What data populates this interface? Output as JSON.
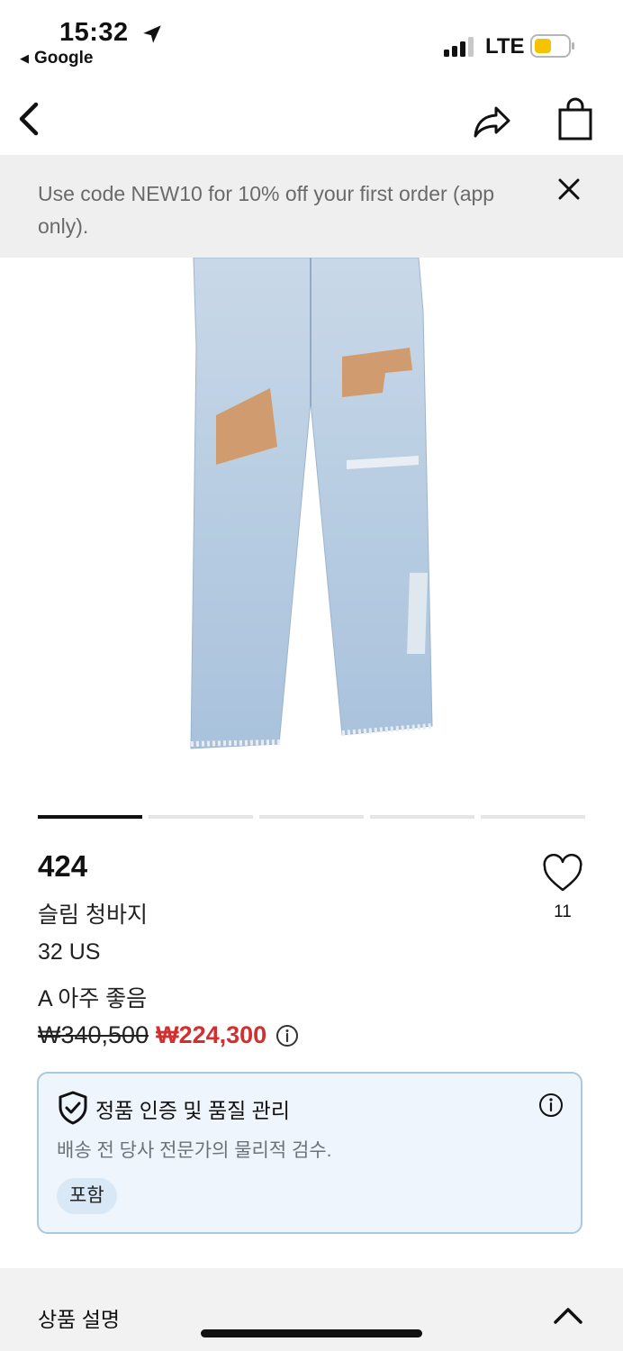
{
  "status_bar": {
    "time": "15:32",
    "back_app": "Google",
    "network": "LTE",
    "battery_color": "#f5c400"
  },
  "nav": {
    "back_icon": "chevron-left-icon",
    "share_icon": "share-icon",
    "bag_icon": "shopping-bag-icon"
  },
  "promo": {
    "text": "Use code NEW10 for 10% off your first order (app only).",
    "close_icon": "close-icon"
  },
  "carousel": {
    "count": 5,
    "active_index": 0
  },
  "product": {
    "brand": "424",
    "name": "슬림 청바지",
    "size": "32 US",
    "condition": "A 아주 좋음",
    "original_price": "₩340,500",
    "sale_price": "₩224,300",
    "likes": "11",
    "sale_color": "#d32f2f"
  },
  "authenticity": {
    "title": "정품 인증 및 품질 관리",
    "description": "배송 전 당사 전문가의 물리적 검수.",
    "badge": "포함"
  },
  "description_section": {
    "title": "상품 설명",
    "chevron_icon": "chevron-up-icon"
  }
}
